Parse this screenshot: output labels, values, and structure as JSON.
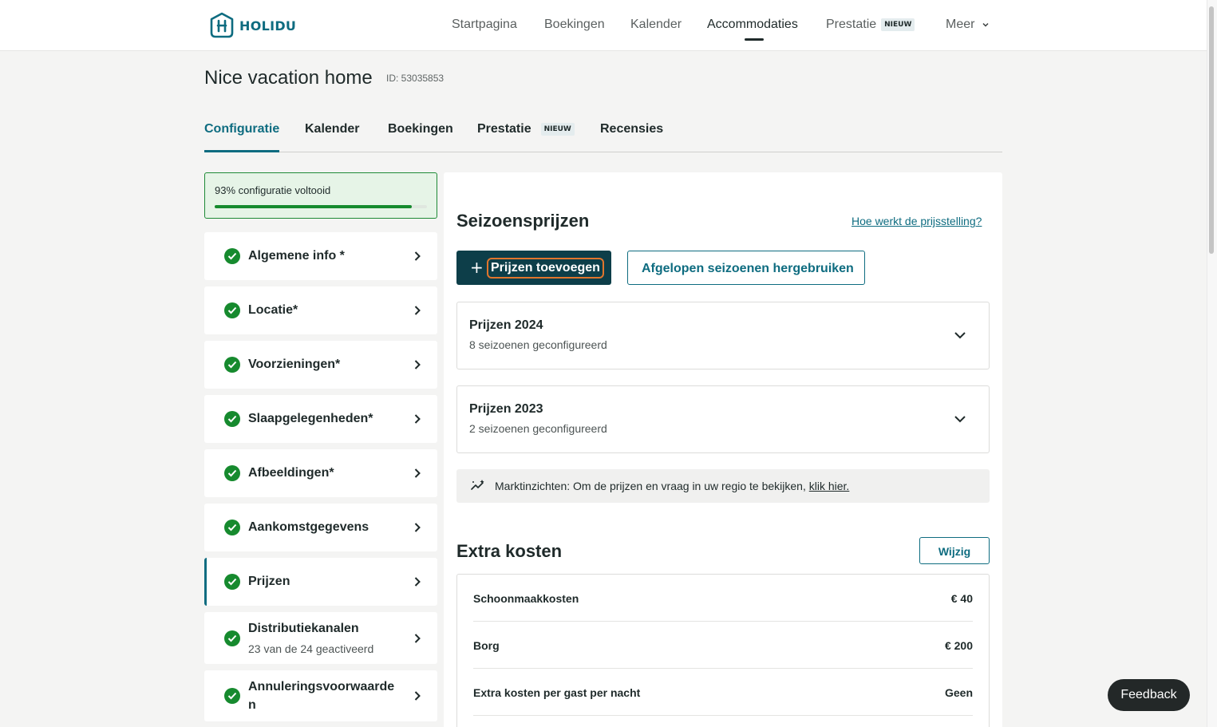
{
  "brand": {
    "name": "HOLIDU",
    "color": "#0e6c80"
  },
  "topnav": {
    "items": [
      {
        "label": "Startpagina"
      },
      {
        "label": "Boekingen"
      },
      {
        "label": "Kalender"
      },
      {
        "label": "Accommodaties",
        "active": true
      },
      {
        "label": "Prestatie",
        "badge": "NIEUW"
      },
      {
        "label": "Meer",
        "dropdown": true
      }
    ]
  },
  "page": {
    "title": "Nice vacation home",
    "id_label": "ID: 53035853"
  },
  "tabs": [
    {
      "label": "Configuratie",
      "active": true
    },
    {
      "label": "Kalender"
    },
    {
      "label": "Boekingen"
    },
    {
      "label": "Prestatie",
      "badge": "NIEUW"
    },
    {
      "label": "Recensies"
    }
  ],
  "sidebar": {
    "progress": {
      "label": "93% configuratie voltooid",
      "percent": 93
    },
    "items": [
      {
        "label": "Algemene info *"
      },
      {
        "label": "Locatie*"
      },
      {
        "label": "Voorzieningen*"
      },
      {
        "label": "Slaapgelegenheden*"
      },
      {
        "label": "Afbeeldingen*"
      },
      {
        "label": "Aankomstgegevens"
      },
      {
        "label": "Prijzen",
        "active": true
      },
      {
        "label": "Distributiekanalen",
        "sub": "23 van de 24 geactiveerd"
      },
      {
        "label": "Annuleringsvoorwaarde",
        "label2": "n"
      }
    ]
  },
  "seasons": {
    "title": "Seizoensprijzen",
    "help_link": "Hoe werkt de prijsstelling?",
    "add_button": "Prijzen toevoegen",
    "reuse_button": "Afgelopen seizoenen hergebruiken",
    "groups": [
      {
        "title": "Prijzen 2024",
        "sub": "8 seizoenen geconfigureerd"
      },
      {
        "title": "Prijzen 2023",
        "sub": "2 seizoenen geconfigureerd"
      }
    ],
    "insight": {
      "text": "Marktinzichten: Om de prijzen en vraag in uw regio te bekijken, ",
      "link": "klik hier."
    }
  },
  "extra_costs": {
    "title": "Extra kosten",
    "edit_button": "Wijzig",
    "rows": [
      {
        "label": "Schoonmaakkosten",
        "value": "€ 40"
      },
      {
        "label": "Borg",
        "value": "€ 200"
      },
      {
        "label": "Extra kosten per gast per nacht",
        "value": "Geen"
      }
    ]
  },
  "feedback": {
    "label": "Feedback"
  }
}
